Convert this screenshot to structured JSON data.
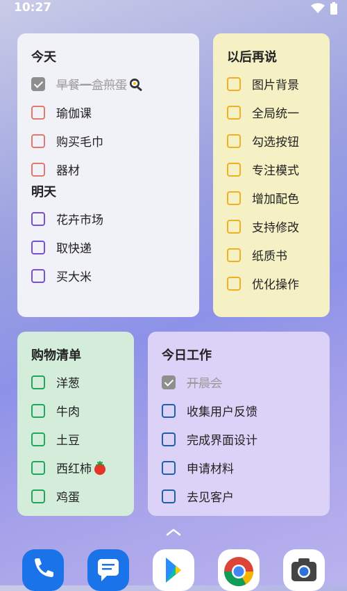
{
  "status": {
    "time": "10:27"
  },
  "today": {
    "title": "今天",
    "items": [
      {
        "label": "早餐一盒煎蛋",
        "done": true
      },
      {
        "label": "瑜伽课",
        "done": false
      },
      {
        "label": "购买毛巾",
        "done": false
      },
      {
        "label": "器材",
        "done": false
      }
    ],
    "tomorrow_title": "明天",
    "tomorrow_items": [
      {
        "label": "花卉市场"
      },
      {
        "label": "取快递"
      },
      {
        "label": "买大米"
      }
    ]
  },
  "later": {
    "title": "以后再说",
    "items": [
      "图片背景",
      "全局统一",
      "勾选按钮",
      "专注模式",
      "增加配色",
      "支持修改",
      "纸质书",
      "优化操作"
    ]
  },
  "shopping": {
    "title": "购物清单",
    "items": [
      "洋葱",
      "牛肉",
      "土豆",
      "西红柿",
      "鸡蛋"
    ]
  },
  "work": {
    "title": "今日工作",
    "items": [
      {
        "label": "开晨会",
        "done": true
      },
      {
        "label": "收集用户反馈",
        "done": false
      },
      {
        "label": "完成界面设计",
        "done": false
      },
      {
        "label": "申请材料",
        "done": false
      },
      {
        "label": "去见客户",
        "done": false
      }
    ]
  },
  "colors": {
    "today_checkbox": "#e07a6c",
    "tomorrow_checkbox": "#7a4fd0",
    "later_checkbox": "#f0b020",
    "shopping_checkbox": "#1fa85a",
    "work_checkbox": "#1d5fa8"
  },
  "dock": {
    "apps": [
      "phone-app",
      "messages-app",
      "play-store-app",
      "chrome-app",
      "camera-app"
    ]
  }
}
